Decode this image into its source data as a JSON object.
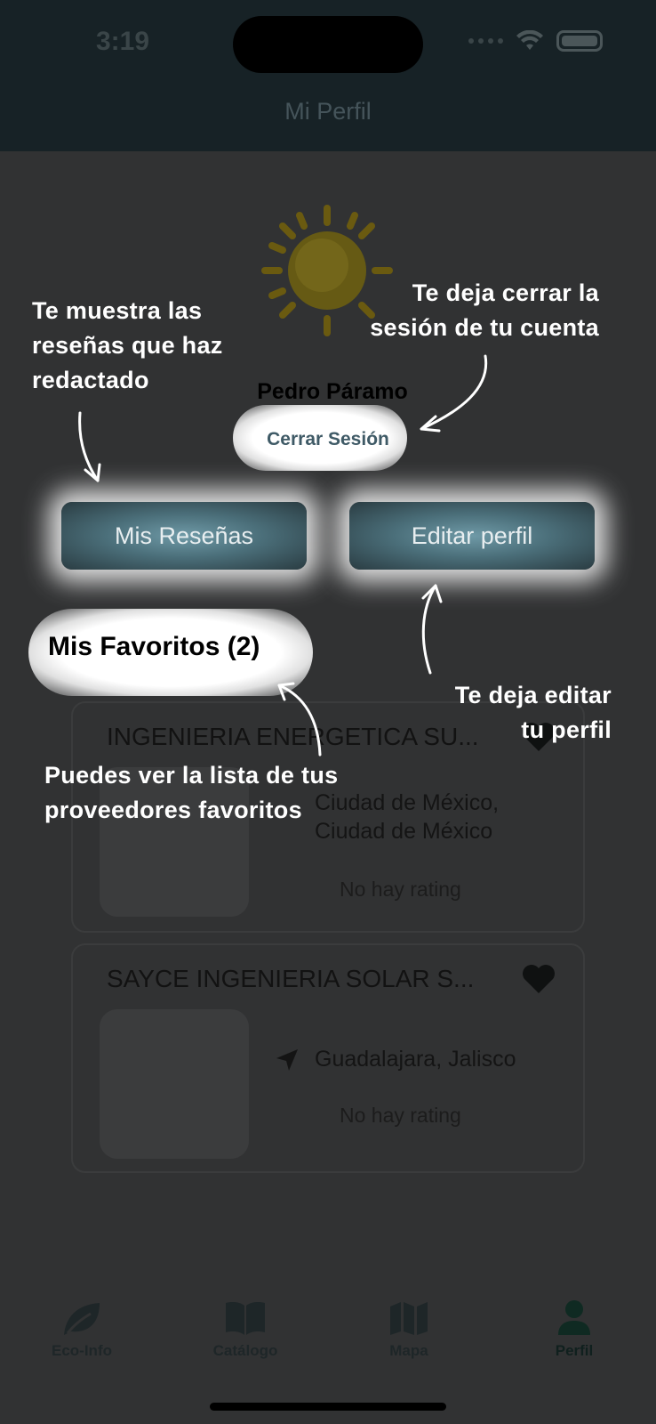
{
  "status_bar": {
    "time": "3:19"
  },
  "header": {
    "title": "Mi Perfil"
  },
  "profile": {
    "name": "Pedro  Páramo",
    "logout_label": "Cerrar Sesión",
    "reviews_button": "Mis Reseñas",
    "edit_button": "Editar perfil"
  },
  "favorites": {
    "title": "Mis Favoritos (2)",
    "items": [
      {
        "name": "INGENIERIA ENERGETICA SU...",
        "location_line1": "Ciudad de México,",
        "location_line2": "Ciudad de México",
        "rating": "No hay rating"
      },
      {
        "name": "SAYCE INGENIERIA SOLAR S...",
        "location_line1": "Guadalajara, Jalisco",
        "rating": "No hay rating"
      }
    ]
  },
  "annotations": {
    "reviews_line1": "Te muestra las",
    "reviews_line2": "reseñas que haz",
    "reviews_line3": "redactado",
    "logout_line1": "Te deja cerrar la",
    "logout_line2": "sesión de tu cuenta",
    "edit_line1": "Te deja editar",
    "edit_line2": "tu perfil",
    "favorites_line1": "Puedes ver la lista de tus",
    "favorites_line2": "proveedores favoritos"
  },
  "tabs": [
    {
      "label": "Eco-Info",
      "icon": "leaf-icon"
    },
    {
      "label": "Catálogo",
      "icon": "book-icon"
    },
    {
      "label": "Mapa",
      "icon": "map-icon"
    },
    {
      "label": "Perfil",
      "icon": "person-icon"
    }
  ],
  "colors": {
    "header_bg": "#172226",
    "overlay_bg": "#313233",
    "button_accent": "#4b6f7a",
    "annotation_text": "#ffffff"
  }
}
